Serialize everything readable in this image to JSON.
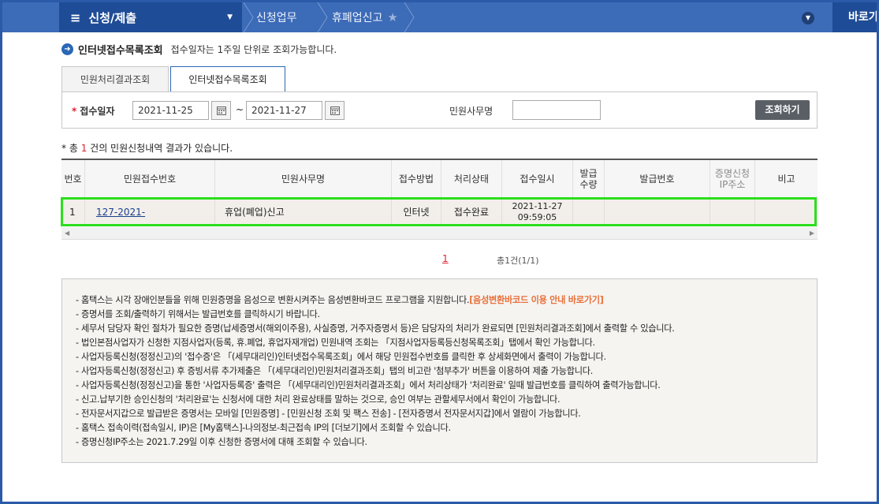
{
  "header": {
    "menu_title": "신청/제출",
    "breadcrumb_1": "신청업무",
    "breadcrumb_2": "휴폐업신고",
    "goto_label": "바로가"
  },
  "page": {
    "title": "인터넷접수목록조회",
    "subtitle": "접수일자는 1주일 단위로 조회가능합니다."
  },
  "tabs": [
    {
      "label": "민원처리결과조회",
      "active": false
    },
    {
      "label": "인터넷접수목록조회",
      "active": true
    }
  ],
  "search": {
    "date_label": "접수일자",
    "date_from": "2021-11-25",
    "tilde": "~",
    "date_to": "2021-11-27",
    "name_label": "민원사무명",
    "name_value": "",
    "button_label": "조회하기"
  },
  "result": {
    "prefix": "* 총",
    "count": "1",
    "suffix": "건의 민원신청내역 결과가 있습니다."
  },
  "table": {
    "headers": [
      "번호",
      "민원접수번호",
      "민원사무명",
      "접수방법",
      "처리상태",
      "접수일시",
      "발급\n수량",
      "발급번호",
      "증명신청\nIP주소",
      "비고"
    ],
    "rows": [
      {
        "no": "1",
        "receipt_no": "127-2021-",
        "office_name": "휴업(폐업)신고",
        "method": "인터넷",
        "status": "접수완료",
        "received_date": "2021-11-27",
        "received_time": "09:59:05",
        "issue_count": "",
        "issue_no": "",
        "ip": "",
        "note": ""
      }
    ]
  },
  "pagination": {
    "current": "1",
    "total": "총1건(1/1)"
  },
  "notice": {
    "lines": [
      {
        "text": "- 홈택스는 시각 장애인분들을 위해 민원증명을 음성으로 변환시켜주는 음성변환바코드 프로그램을 지원합니다.",
        "link": "[음성변환바코드 이용 안내 바로가기]"
      },
      {
        "text": "- 증명서를 조회/출력하기 위해서는 발급번호를 클릭하시기 바랍니다."
      },
      {
        "text": "- 세무서 담당자 확인 절차가 필요한 증명(납세증명서(해외이주용), 사실증명, 거주자증명서 등)은 담당자의 처리가 완료되면 [민원처리결과조회]에서 출력할 수 있습니다."
      },
      {
        "text": "- 법인본점사업자가 신청한 지점사업자(등록, 휴.폐업, 휴업자재개업) 민원내역 조회는 「지점사업자등록등신청목록조회」탭에서 확인 가능합니다."
      },
      {
        "text": "- 사업자등록신청(정정신고)의 '접수증'은 「(세무대리인)인터넷접수목록조회」에서 해당 민원접수번호를 클릭한 후 상세화면에서 출력이 가능합니다."
      },
      {
        "text": "- 사업자등록신청(정정신고) 후 증빙서류 추가제출은 「(세무대리인)민원처리결과조회」탭의 비고란 '첨부추가' 버튼을 이용하여 제출 가능합니다."
      },
      {
        "text": "- 사업자등록신청(정정신고)을 통한 '사업자등록증' 출력은 「(세무대리인)민원처리결과조회」에서 처리상태가 '처리완료' 일때 발급번호를 클릭하여 출력가능합니다."
      },
      {
        "text": "- 신고.납부기한 승인신청의 '처리완료'는 신청서에 대한 처리 완료상태를 말하는 것으로, 승인 여부는 관할세무서에서 확인이 가능합니다."
      },
      {
        "text": "- 전자문서지갑으로 발급받은 증명서는 모바일 [민원증명] - [민원신청 조회 및 팩스 전송] - [전자증명서 전자문서지갑]에서 열람이 가능합니다."
      },
      {
        "text": "- 홈택스 접속이력(접속일시, IP)은 [My홈택스]-나의정보-최근접속 IP의 [더보기]에서 조회할 수 있습니다."
      },
      {
        "text": "- 증명신청IP주소는 2021.7.29일 이후 신청한 증명서에 대해 조회할 수 있습니다."
      }
    ]
  },
  "colors": {
    "topbar": "#3c6bb8",
    "menu": "#1f4c96",
    "highlight": "#2bdf1c",
    "accent_red": "#dd2233",
    "link_orange": "#e8703a"
  }
}
